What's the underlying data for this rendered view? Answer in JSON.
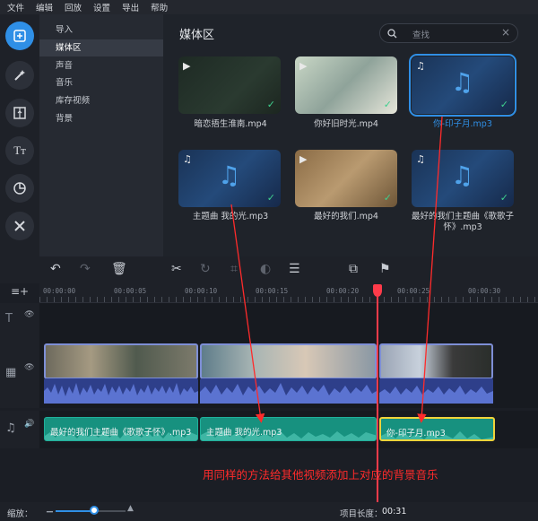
{
  "menu": [
    "文件",
    "编辑",
    "回放",
    "设置",
    "导出",
    "帮助"
  ],
  "sidebar_icons": [
    "import-icon",
    "magic-icon",
    "transition-icon",
    "title-icon",
    "sticker-icon",
    "tools-icon"
  ],
  "subnav": [
    "导入",
    "媒体区",
    "声音",
    "音乐",
    "库存视频",
    "背景"
  ],
  "media": {
    "title": "媒体区",
    "search_placeholder": "查找",
    "items": [
      {
        "label": "暗恋捂生淮南.mp4"
      },
      {
        "label": "你好旧时光.mp4"
      },
      {
        "label": "你-印子月.mp3"
      },
      {
        "label": "主题曲 我的光.mp3"
      },
      {
        "label": "最好的我们.mp4"
      },
      {
        "label": "最好的我们主题曲《歌歌子怀》.mp3"
      }
    ]
  },
  "ruler": [
    "00:00:00",
    "00:00:05",
    "00:00:10",
    "00:00:15",
    "00:00:20",
    "00:00:25",
    "00:00:30"
  ],
  "music_clips": [
    "最好的我们主题曲《歌歌子怀》.mp3",
    "主题曲 我的光.mp3",
    "你-印子月.mp3"
  ],
  "annotation": "用同样的方法给其他视频添加上对应的背景音乐",
  "status": {
    "zoom_label": "缩放：",
    "length_label": "项目长度：",
    "length_value": "00:31"
  },
  "colors": {
    "accent": "#2f8fe6",
    "music_clip": "#17917f",
    "selected_clip": "#f0d43a",
    "annotation": "#ff2b2b"
  }
}
